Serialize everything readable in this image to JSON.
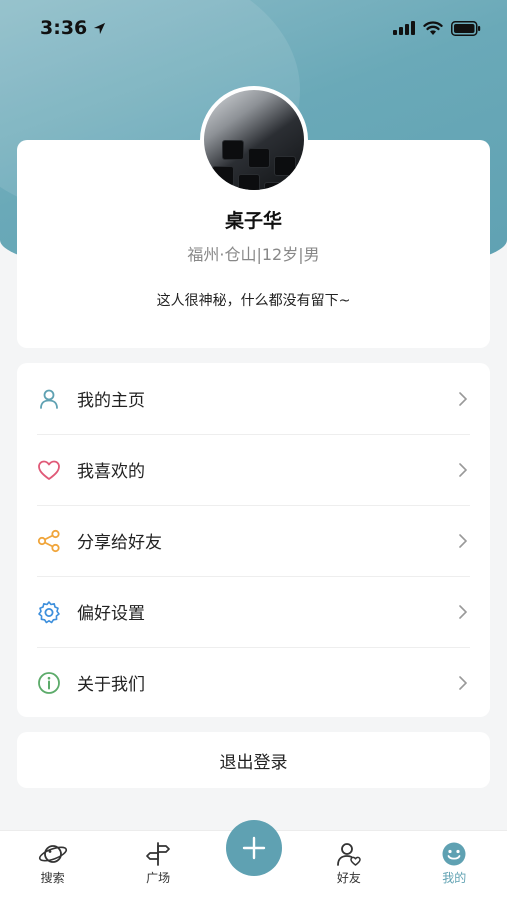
{
  "status_bar": {
    "time": "3:36"
  },
  "profile": {
    "name": "桌子华",
    "location_age_gender": "福州·仓山|12岁|男",
    "bio": "这人很神秘，什么都没有留下~"
  },
  "menu": [
    {
      "label": "我的主页",
      "icon": "user-icon",
      "color": "#5fa1b2"
    },
    {
      "label": "我喜欢的",
      "icon": "heart-icon",
      "color": "#e05a78"
    },
    {
      "label": "分享给好友",
      "icon": "share-icon",
      "color": "#f0a53b"
    },
    {
      "label": "偏好设置",
      "icon": "gear-icon",
      "color": "#3d8fdc"
    },
    {
      "label": "关于我们",
      "icon": "info-icon",
      "color": "#5cab6a"
    }
  ],
  "logout_label": "退出登录",
  "tabbar": {
    "items": [
      {
        "label": "搜索",
        "icon": "planet-icon"
      },
      {
        "label": "广场",
        "icon": "signpost-icon"
      },
      {
        "label": "好友",
        "icon": "friend-icon"
      },
      {
        "label": "我的",
        "icon": "smile-icon",
        "active": true
      }
    ]
  },
  "colors": {
    "accent": "#5fa1b2"
  }
}
